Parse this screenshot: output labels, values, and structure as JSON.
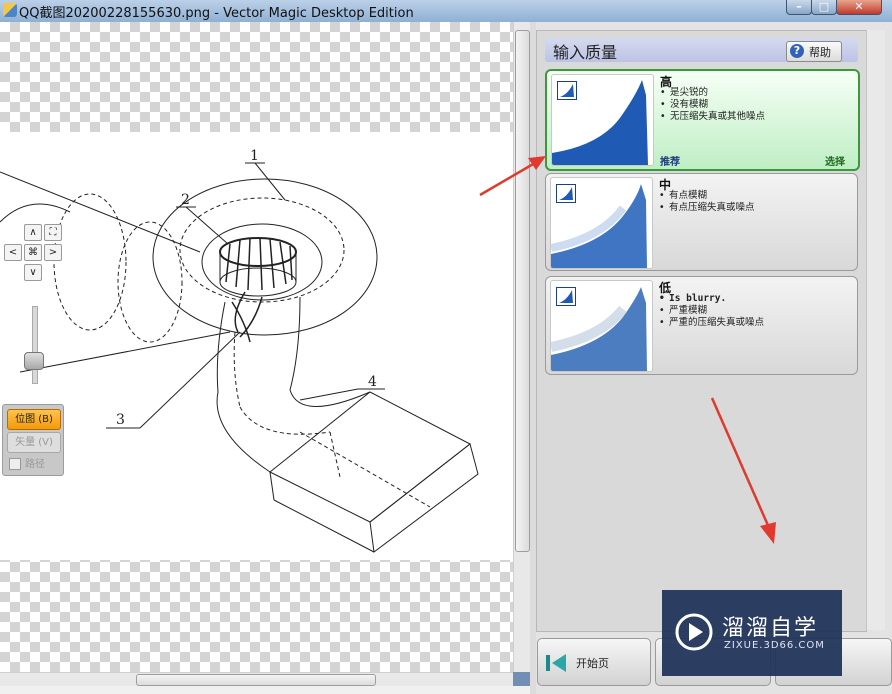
{
  "window": {
    "title": "QQ截图20200228155630.png - Vector Magic Desktop Edition",
    "min_label": "–",
    "max_label": "□",
    "close_label": "✕"
  },
  "drawing": {
    "labels": [
      "1",
      "2",
      "3",
      "4"
    ]
  },
  "nav": {
    "up": "∧",
    "down": "∨",
    "left": "<",
    "right": ">",
    "center": "⌘",
    "fit": "⛶"
  },
  "view_mode": {
    "bitmap": "位图 (B)",
    "vector": "矢量 (V)",
    "paths": "路径"
  },
  "quality_panel": {
    "title": "输入质量",
    "help": "帮助",
    "options": [
      {
        "title": "高",
        "bullets": [
          "是尖锐的",
          "没有模糊",
          "无压缩失真或其他噪点"
        ],
        "recommended": "推荐",
        "select": "选择",
        "selected": true
      },
      {
        "title": "中",
        "bullets": [
          "有点模糊",
          "有点压缩失真或噪点"
        ]
      },
      {
        "title": "低",
        "bullets": [
          "Is blurry.",
          "严重模糊",
          "严重的压缩失真或噪点"
        ]
      }
    ]
  },
  "bottom_buttons": {
    "home": "开始页"
  },
  "watermark": {
    "title": "溜溜自学",
    "url": "ZIXUE.3D66.COM"
  },
  "colors": {
    "accent_green": "#3a9a3a",
    "annotation_red": "#e03a2f",
    "header_lavender": "#c8cdea",
    "thumbnail_blue": "#1f5bb5",
    "bitmap_orange": "#f5a31a"
  },
  "icons": [
    "app-icon",
    "help-icon",
    "vector-magic-icon",
    "home-icon",
    "watermark-logo-icon"
  ]
}
